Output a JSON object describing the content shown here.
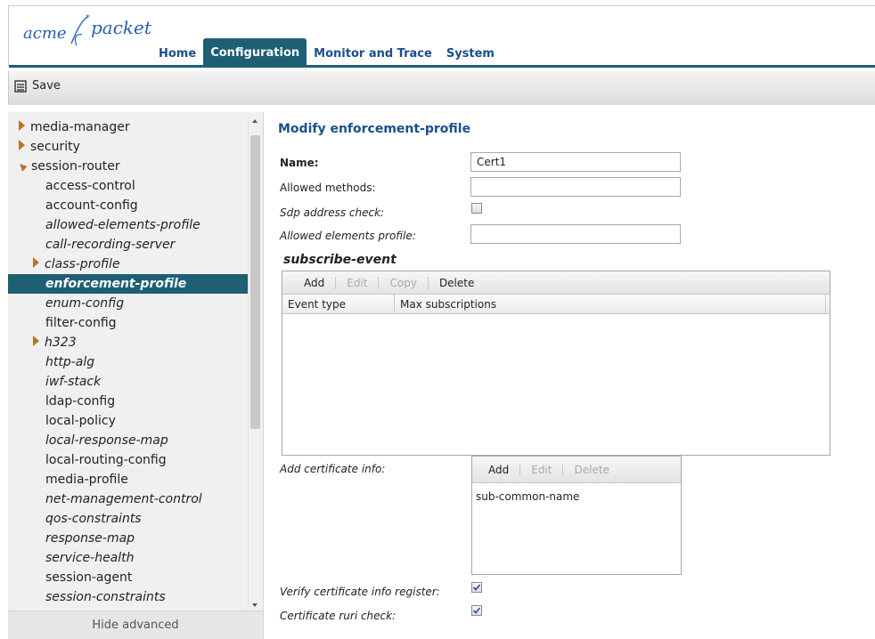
{
  "header": {
    "logo_acme": "acme",
    "logo_packet": "packet",
    "tabs": [
      "Home",
      "Configuration",
      "Monitor and Trace",
      "System"
    ],
    "active_tab": "Configuration"
  },
  "toolbar": {
    "save_label": "Save"
  },
  "sidebar": {
    "items": [
      {
        "label": "media-manager"
      },
      {
        "label": "security"
      },
      {
        "label": "session-router"
      },
      {
        "label": "access-control"
      },
      {
        "label": "account-config"
      },
      {
        "label": "allowed-elements-profile"
      },
      {
        "label": "call-recording-server"
      },
      {
        "label": "class-profile"
      },
      {
        "label": "enforcement-profile"
      },
      {
        "label": "enum-config"
      },
      {
        "label": "filter-config"
      },
      {
        "label": "h323"
      },
      {
        "label": "http-alg"
      },
      {
        "label": "iwf-stack"
      },
      {
        "label": "ldap-config"
      },
      {
        "label": "local-policy"
      },
      {
        "label": "local-response-map"
      },
      {
        "label": "local-routing-config"
      },
      {
        "label": "media-profile"
      },
      {
        "label": "net-management-control"
      },
      {
        "label": "qos-constraints"
      },
      {
        "label": "response-map"
      },
      {
        "label": "service-health"
      },
      {
        "label": "session-agent"
      },
      {
        "label": "session-constraints"
      }
    ],
    "hide_advanced_label": "Hide advanced"
  },
  "form": {
    "title": "Modify enforcement-profile",
    "name_label": "Name:",
    "name_value": "Cert1",
    "allowed_methods_label": "Allowed methods:",
    "allowed_methods_value": "",
    "sdp_address_check_label": "Sdp address check:",
    "allowed_elements_profile_label": "Allowed elements profile:",
    "allowed_elements_profile_value": "",
    "subscribe_event": {
      "title": "subscribe-event",
      "buttons": [
        "Add",
        "Edit",
        "Copy",
        "Delete"
      ],
      "columns": [
        "Event type",
        "Max subscriptions"
      ]
    },
    "add_certificate_info_label": "Add certificate info:",
    "certificate_info": {
      "buttons": [
        "Add",
        "Edit",
        "Delete"
      ],
      "rows": [
        "sub-common-name"
      ]
    },
    "verify_certificate_info_register_label": "Verify certificate info register:",
    "certificate_ruri_check_label": "Certificate ruri check:"
  }
}
